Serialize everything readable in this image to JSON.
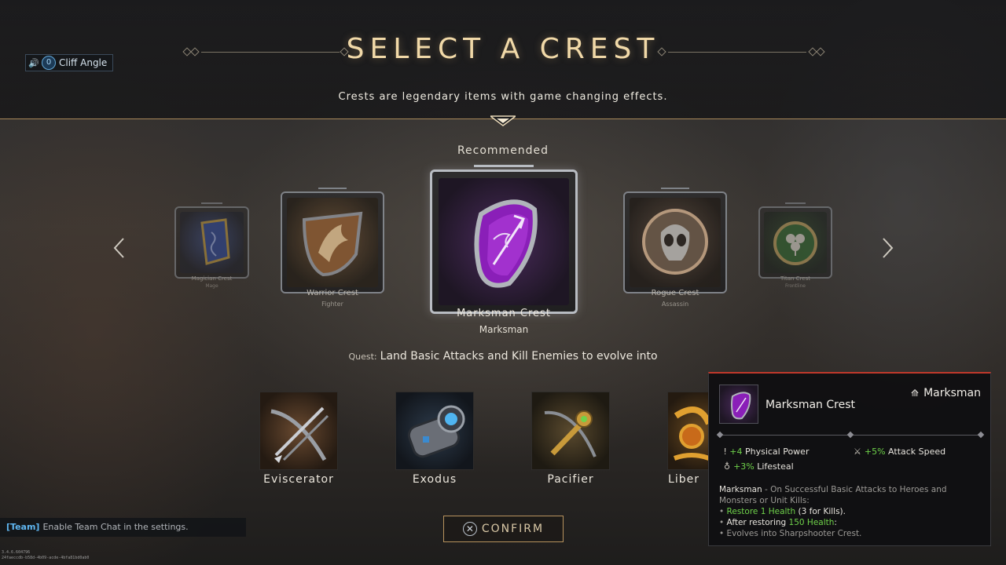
{
  "header": {
    "title": "SELECT A CREST",
    "subtitle": "Crests are legendary items with game changing effects."
  },
  "voice": {
    "speaker_icon": "speaker-icon",
    "badge": "0",
    "player_name": "Cliff Angle"
  },
  "carousel": {
    "recommended_label": "Recommended",
    "crests": [
      {
        "name": "Magician Crest",
        "role": "Mage",
        "color": "#2b4c9e"
      },
      {
        "name": "Warrior Crest",
        "role": "Fighter",
        "color": "#8a5a32"
      },
      {
        "name": "Marksman Crest",
        "role": "Marksman",
        "color": "#9a2bc9"
      },
      {
        "name": "Rogue Crest",
        "role": "Assassin",
        "color": "#7a6a58"
      },
      {
        "name": "Titan Crest",
        "role": "Frontline",
        "color": "#2f6a2f"
      }
    ]
  },
  "quest": {
    "label": "Quest:",
    "text": "Land Basic Attacks and Kill Enemies to evolve into"
  },
  "evolutions": [
    {
      "name": "Eviscerator"
    },
    {
      "name": "Exodus"
    },
    {
      "name": "Pacifier"
    },
    {
      "name": "Liber"
    }
  ],
  "confirm": {
    "button_glyph": "✕",
    "label": "CONFIRM"
  },
  "chat": {
    "channel": "[Team]",
    "message": "Enable Team Chat in the settings."
  },
  "build_info": {
    "line1": "3.4.6.604796",
    "line2": "24faeccdb-b58d-4b09-acde-4bfa81bd0ab0"
  },
  "tooltip": {
    "name": "Marksman Crest",
    "role": "Marksman",
    "stats": [
      {
        "value": "+4",
        "label": "Physical Power"
      },
      {
        "value": "+5%",
        "label": "Attack Speed"
      },
      {
        "value": "+3%",
        "label": "Lifesteal"
      }
    ],
    "desc_title": "Marksman",
    "desc_intro": " - On Successful Basic Attacks to Heroes and Monsters or Unit Kills:",
    "bullet1_green": "Restore 1 Health",
    "bullet1_rest": " (3 for Kills).",
    "bullet2_white": "After restoring ",
    "bullet2_green": "150 Health",
    "bullet2_rest": ":",
    "bullet3": "Evolves into Sharpshooter Crest."
  },
  "colors": {
    "accent_gold": "#f1d9a8",
    "divider_gold": "#a8885a",
    "stat_green": "#6fd24a",
    "tooltip_border": "#c0392b",
    "team_blue": "#5fb6f0"
  }
}
